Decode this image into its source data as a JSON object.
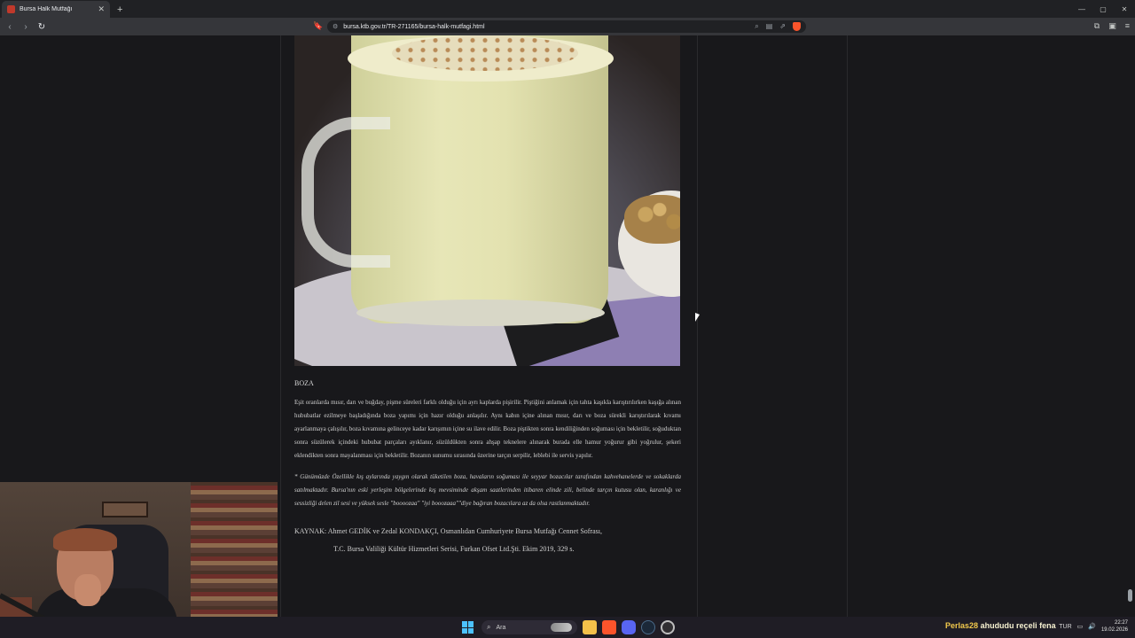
{
  "browser": {
    "tab": {
      "title": "Bursa Halk Mutfağı",
      "close": "✕"
    },
    "new_tab": "+",
    "window_controls": {
      "minimize": "—",
      "maximize": "▢",
      "close": "✕"
    },
    "nav": {
      "back": "‹",
      "forward": "›",
      "reload": "↻"
    },
    "bookmark": "🔖",
    "url": "bursa.ktb.gov.tr/TR-271165/bursa-halk-mutfagi.html",
    "site_icon": "⚙",
    "url_icons": {
      "zoom": "⌕",
      "reader": "▤",
      "share": "⇗"
    },
    "right_icons": {
      "extensions": "⧉",
      "sidebar": "▣",
      "menu": "≡"
    },
    "accent_color": "#fb542b"
  },
  "article": {
    "image_alt_icon": "boza-photo",
    "section_title": "BOZA",
    "paragraph": "Eşit oranlarda mısır, darı ve buğday, pişme süreleri farklı olduğu için ayrı kaplarda pişirilir. Piştiğini anlamak için tahta kaşıkla karıştırılırken kaşığa alınan hububatlar ezilmeye başladığında boza yapımı için hazır olduğu anlaşılır. Aynı kabın içine alınan mısır, darı ve boza sürekli karıştırılarak kıvamı ayarlanmaya çalışılır, boza kıvamına gelinceye kadar karışımın içine su ilave edilir. Boza piştikten sonra kendiliğinden soğuması için bekletilir, soğuduktan sonra süzülerek içindeki hububat parçaları ayıklanır, süzüldükten sonra ahşap teknelere alınarak burada elle hamur yoğurur gibi yoğrulur, şekeri eklendikten sonra mayalanması için bekletilir. Bozanın sunumu sırasında üzerine tarçın serpilir, leblebi ile servis yapılır.",
    "note": "* Günümüzde Özellikle kış aylarında yaygın olarak tüketilen boza, havaların soğuması ile seyyar bozacılar tarafından kahvehanelerde ve sokaklarda satılmaktadır. Bursa'nın eski yerleşim bölgelerinde kış mevsiminde akşam saatlerinden itibaren elinde zili, belinde tarçın kutusu olan, karanlığı ve sessizliği delen zil sesi ve yüksek sesle \"boooozaa\" \"iyi booozaaa\"\"diye bağıran bozacılara az da olsa rastlanmaktadır.",
    "source_line1": "KAYNAK: Ahmet GEDİK ve Zedal KONDAKÇI, Osmanlıdan Cumhuriyete Bursa Mutfağı Cennet Sofrası,",
    "source_line2": "T.C. Bursa Valiliği Kültür Hizmetleri Serisi, Furkan Ofset Ltd.Şti. Ekim 2019, 329 s."
  },
  "taskbar": {
    "search_icon": "⌕",
    "search_placeholder": "Ara",
    "ticker_user": "Perlas28",
    "ticker_text": "ahududu reçeli fena",
    "tray_lang": "TUR",
    "tray_icons": {
      "network": "▭",
      "volume": "🔊"
    },
    "time": "22:27",
    "date": "19.02.2026"
  }
}
